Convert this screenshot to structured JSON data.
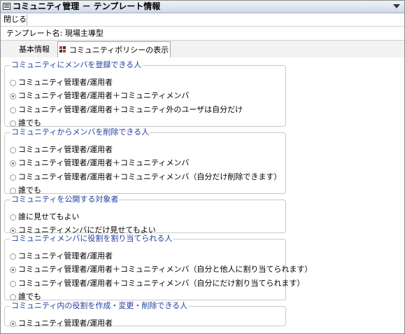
{
  "window": {
    "title": "コミュニティ管理 － テンプレート情報"
  },
  "toolbar": {
    "close_label": "閉じる"
  },
  "template_name": "テンプレート名: 現場主導型",
  "tabs": [
    {
      "label": "基本情報"
    },
    {
      "label": "コミュニティポリシーの表示"
    }
  ],
  "groups": [
    {
      "legend": "コミュニティにメンバを登録できる人",
      "options": [
        {
          "label": "コミュニティ管理者/運用者",
          "selected": false
        },
        {
          "label": "コミュニティ管理者/運用者＋コミュニティメンバ",
          "selected": true
        },
        {
          "label": "コミュニティ管理者/運用者＋コミュニティ外のユーザは自分だけ",
          "selected": false
        },
        {
          "label": "誰でも",
          "selected": false
        }
      ]
    },
    {
      "legend": "コミュニティからメンバを削除できる人",
      "options": [
        {
          "label": "コミュニティ管理者/運用者",
          "selected": false
        },
        {
          "label": "コミュニティ管理者/運用者＋コミュニティメンバ",
          "selected": true
        },
        {
          "label": "コミュニティ管理者/運用者＋コミュニティメンバ（自分だけ削除できます）",
          "selected": false
        },
        {
          "label": "誰でも",
          "selected": false
        }
      ]
    },
    {
      "legend": "コミュニティを公開する対象者",
      "options": [
        {
          "label": "誰に見せてもよい",
          "selected": false
        },
        {
          "label": "コミュニティメンバにだけ見せてもよい",
          "selected": true
        }
      ]
    },
    {
      "legend": "コミュニティメンバに役割を割り当てられる人",
      "options": [
        {
          "label": "コミュニティ管理者/運用者",
          "selected": false
        },
        {
          "label": "コミュニティ管理者/運用者＋コミュニティメンバ（自分と他人に割り当てられます）",
          "selected": true
        },
        {
          "label": "コミュニティ管理者/運用者＋コミュニティメンバ（自分にだけ割り当てられます）",
          "selected": false
        },
        {
          "label": "誰でも",
          "selected": false
        }
      ]
    },
    {
      "legend": "コミュニティ内の役割を作成・変更・削除できる人",
      "options": [
        {
          "label": "コミュニティ管理者/運用者",
          "selected": true
        }
      ]
    }
  ],
  "colors": {
    "legend_text": "#1f3ea0",
    "titlebar": "#cfdae8",
    "tab_icon": [
      "#c0392b",
      "#3a3a3a"
    ]
  }
}
